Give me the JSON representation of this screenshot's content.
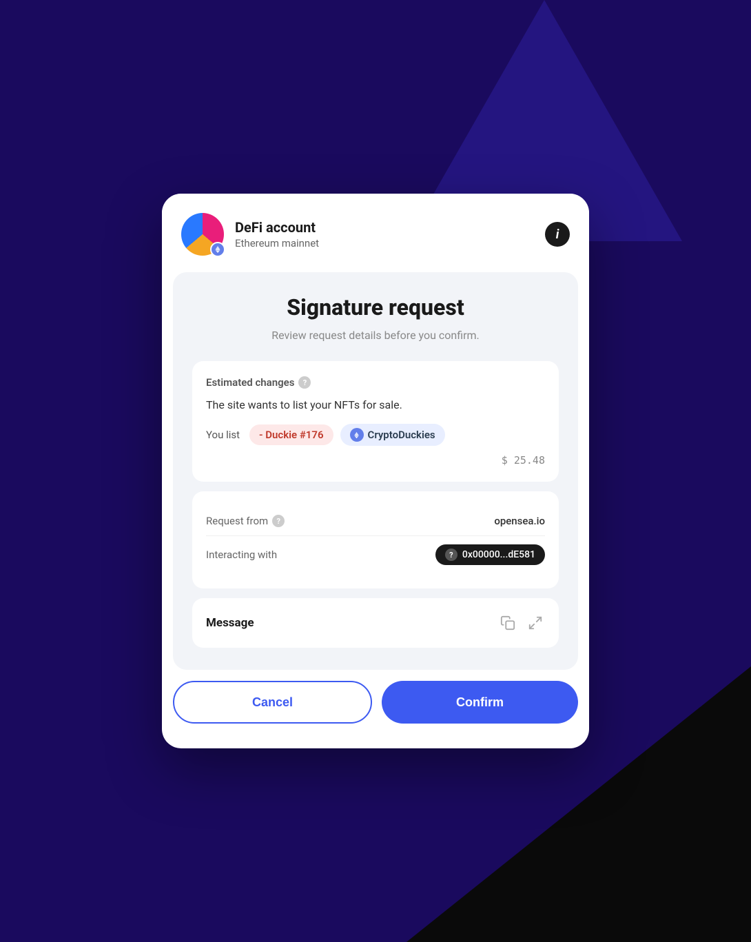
{
  "header": {
    "account_name": "DeFi account",
    "network_name": "Ethereum mainnet",
    "info_label": "i"
  },
  "page": {
    "title": "Signature request",
    "subtitle": "Review request details before you confirm."
  },
  "estimated_changes": {
    "section_title": "Estimated changes",
    "description": "The site wants to list your NFTs for sale.",
    "you_list_label": "You list",
    "nft_name": "- Duckie #176",
    "collection_name": "CryptoDuckies",
    "price": "$ 25.48"
  },
  "request_info": {
    "request_from_label": "Request from",
    "request_from_value": "opensea.io",
    "interacting_with_label": "Interacting with",
    "interacting_with_value": "0x00000...dE581"
  },
  "message": {
    "title": "Message"
  },
  "buttons": {
    "cancel_label": "Cancel",
    "confirm_label": "Confirm"
  }
}
